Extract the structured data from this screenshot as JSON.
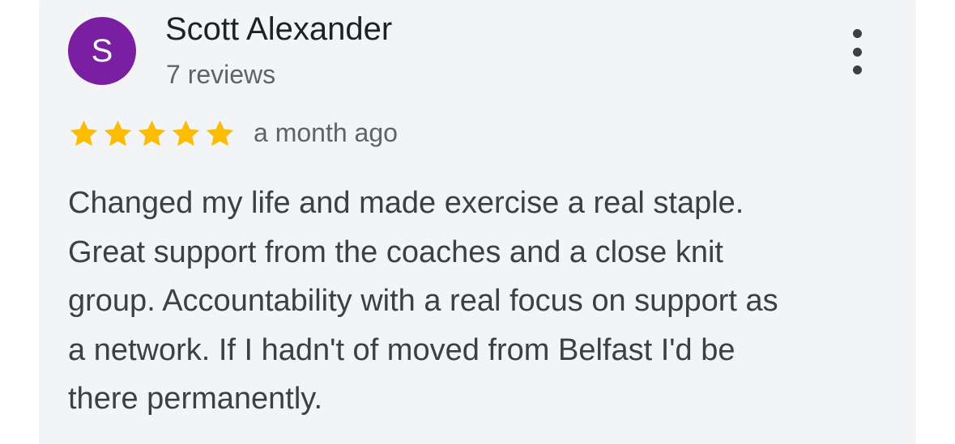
{
  "reviewer": {
    "initial": "S",
    "name": "Scott Alexander",
    "review_count": "7 reviews",
    "avatar_color": "#7b1fa2"
  },
  "menu": {
    "icon": "more-vert-icon"
  },
  "review": {
    "rating": 5,
    "rating_max": 5,
    "star_color": "#fbbc04",
    "date": "a month ago",
    "text_lines": [
      "Changed my life and made exercise a real staple.",
      "Great support from the coaches and a close knit",
      "group. Accountability with a real focus on support as",
      "a network. If I hadn't of moved from Belfast I'd be",
      "there permanently."
    ]
  }
}
